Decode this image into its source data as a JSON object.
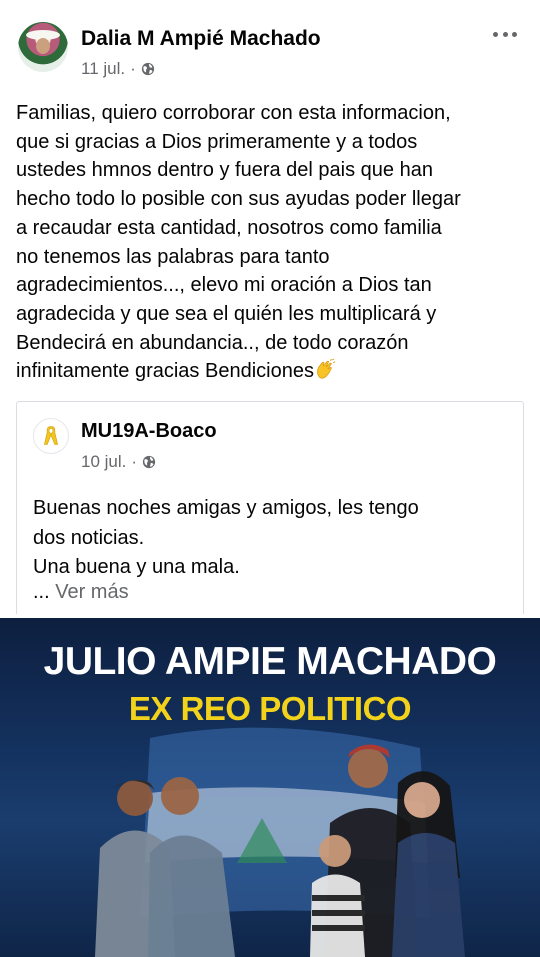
{
  "post": {
    "author": "Dalia M Ampié Machado",
    "date": "11 jul.",
    "separator": "·",
    "privacy_icon": "globe-icon",
    "more_icon": "more-horizontal-icon",
    "text_lines": [
      "Familias, quiero corroborar con esta informacion,",
      "que si gracias a Dios primeramente y a todos",
      "ustedes hmnos dentro y fuera del pais que han",
      "hecho todo lo posible con sus ayudas poder llegar",
      "a recaudar esta cantidad, nosotros como familia",
      "no tenemos las palabras para tanto",
      "agradecimientos..., elevo mi oración a Dios tan",
      "agradecida y que sea el quién les multiplicará y",
      "Bendecirá en abundancia.., de todo corazón",
      "infinitamente gracias Bendiciones"
    ],
    "emoji_icon": "clapping-hands-icon"
  },
  "shared": {
    "author": "MU19A-Boaco",
    "date": "10 jul.",
    "separator": "·",
    "avatar_icon": "yellow-ribbon-icon",
    "text_lines": [
      "Buenas noches amigas y amigos, les tengo",
      "dos noticias.",
      "Una buena y una mala."
    ],
    "see_more_dots": "...",
    "see_more_label": "Ver más"
  },
  "photo": {
    "headline": "JULIO AMPIE MACHADO",
    "subheadline": "EX REO POLITICO"
  },
  "colors": {
    "text": "#050505",
    "secondary": "#65676b",
    "headline": "#ffffff",
    "subheadline": "#f2d21b",
    "banner_bg": "#13305c"
  }
}
